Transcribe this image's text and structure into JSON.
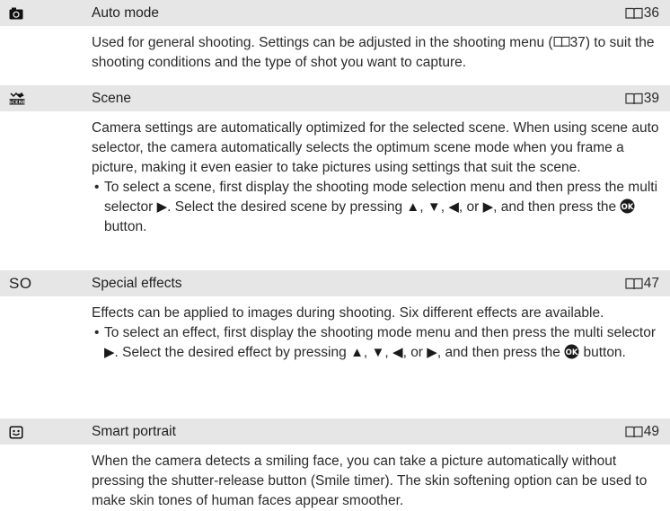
{
  "modes": [
    {
      "icon": "camera-icon",
      "title": "Auto mode",
      "page_ref": "36",
      "description": {
        "pre": "Used for general shooting. Settings can be adjusted in the shooting menu (",
        "ref": "37",
        "post": ") to suit the shooting conditions and the type of shot you want to capture."
      }
    },
    {
      "icon": "scene-icon",
      "title": "Scene",
      "page_ref": "39",
      "description": "Camera settings are automatically optimized for the selected scene. When using scene auto selector, the camera automatically selects the optimum scene mode when you frame a picture, making it even easier to take pictures using settings that suit the scene.",
      "bullet": {
        "a": "To select a scene, first display the shooting mode selection menu and then press the multi selector ",
        "b": ". Select the desired scene by pressing ",
        "sep1": ", ",
        "sep2": ", ",
        "sep3": ", or ",
        "c": ", and then press the ",
        "d": " button."
      }
    },
    {
      "icon_text": "SO",
      "title": "Special effects",
      "page_ref": "47",
      "description": "Effects can be applied to images during shooting. Six different effects are available.",
      "bullet": {
        "a": "To select an effect, first display the shooting mode menu and then press the multi selector ",
        "b": ". Select the desired effect by pressing ",
        "sep1": ", ",
        "sep2": ", ",
        "sep3": ", or ",
        "c": ", and then press the ",
        "d": " button."
      }
    },
    {
      "icon": "smart-portrait-icon",
      "title": "Smart portrait",
      "page_ref": "49",
      "description": "When the camera detects a smiling face, you can take a picture automatically without pressing the shutter-release button (Smile timer). The skin softening option can be used to make skin tones of human faces appear smoother."
    }
  ],
  "glyphs": {
    "bullet": "•",
    "right": "▶",
    "up": "▲",
    "down": "▼",
    "left": "◀"
  }
}
